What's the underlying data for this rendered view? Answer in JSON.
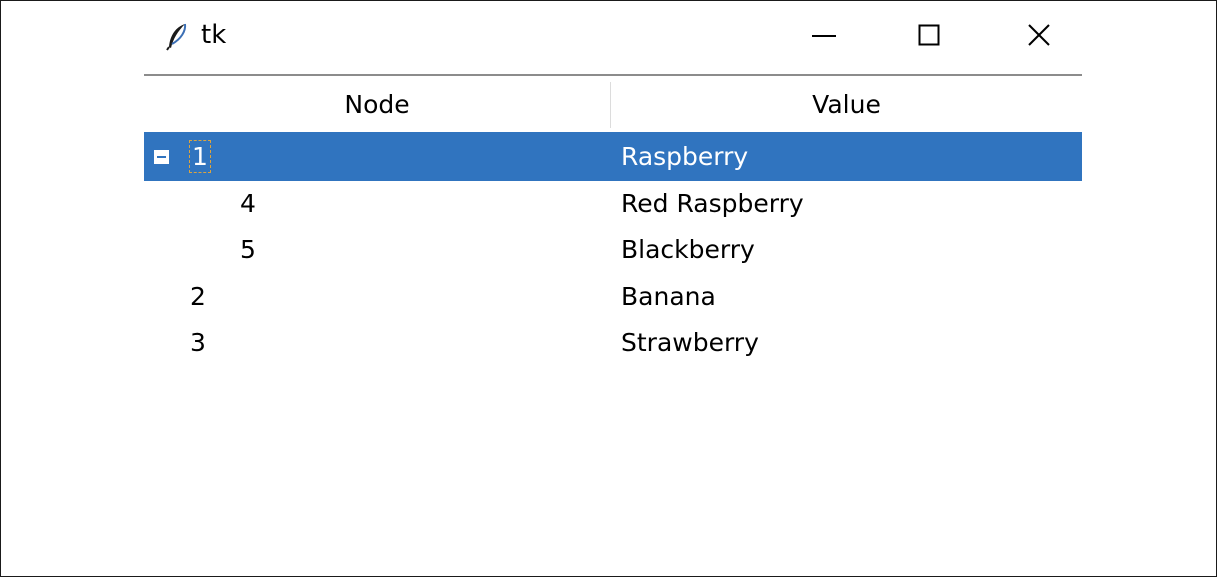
{
  "window": {
    "title": "tk",
    "icon": "feather-icon",
    "controls": [
      "minimize-icon",
      "maximize-icon",
      "close-icon"
    ]
  },
  "tree": {
    "columns": [
      "Node",
      "Value"
    ],
    "rows": [
      {
        "node": "1",
        "value": "Raspberry",
        "expanded": true,
        "selected": true,
        "level": 0
      },
      {
        "node": "4",
        "value": "Red Raspberry",
        "selected": false,
        "level": 1
      },
      {
        "node": "5",
        "value": "Blackberry",
        "selected": false,
        "level": 1
      },
      {
        "node": "2",
        "value": "Banana",
        "selected": false,
        "level": 0
      },
      {
        "node": "3",
        "value": "Strawberry",
        "selected": false,
        "level": 0
      }
    ]
  },
  "colors": {
    "selection": "#3074bf",
    "selection_text": "#ffffff"
  }
}
